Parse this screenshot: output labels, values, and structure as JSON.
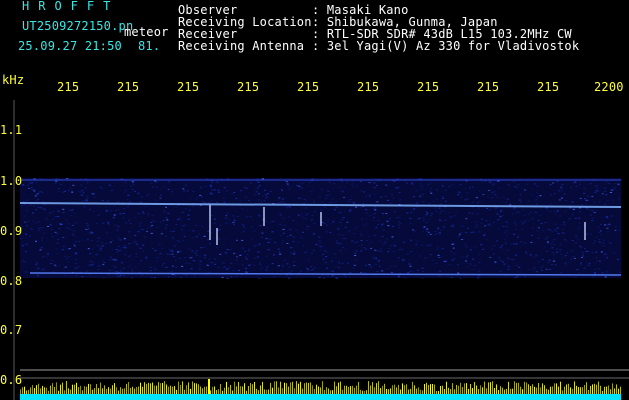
{
  "header": {
    "logo": "HROFFT",
    "filename": "UT2509272150.pn",
    "event_type": "meteor",
    "datetime": "25.09.27 21:50",
    "count": "81.",
    "rows": [
      {
        "label": "Observer",
        "value": ": Masaki Kano"
      },
      {
        "label": "Receiving Location",
        "value": ": Shibukawa, Gunma, Japan"
      },
      {
        "label": "Receiver",
        "value": ": RTL-SDR SDR# 43dB L15 103.2MHz CW"
      },
      {
        "label": "Receiving Antenna",
        "value": ": 3el Yagi(V) Az 330 for Vladivostok"
      }
    ]
  },
  "axes": {
    "y_unit": "kHz",
    "y_ticks": [
      "1.1",
      "1.0",
      "0.9",
      "0.8",
      "0.7",
      "0.6"
    ],
    "x_ticks": [
      "215",
      "215",
      "215",
      "215",
      "215",
      "215",
      "215",
      "215",
      "215",
      "2200"
    ]
  },
  "colors": {
    "text_cyan": "#39e6e6",
    "text_white": "#ffffff",
    "text_yellow": "#ffff33",
    "plot_background": "#000000",
    "noise_blue": "#1a2fb8",
    "echo_line": "#7fb2ff",
    "level_bars": "#ffff00",
    "level_base": "#00e5ff"
  }
}
